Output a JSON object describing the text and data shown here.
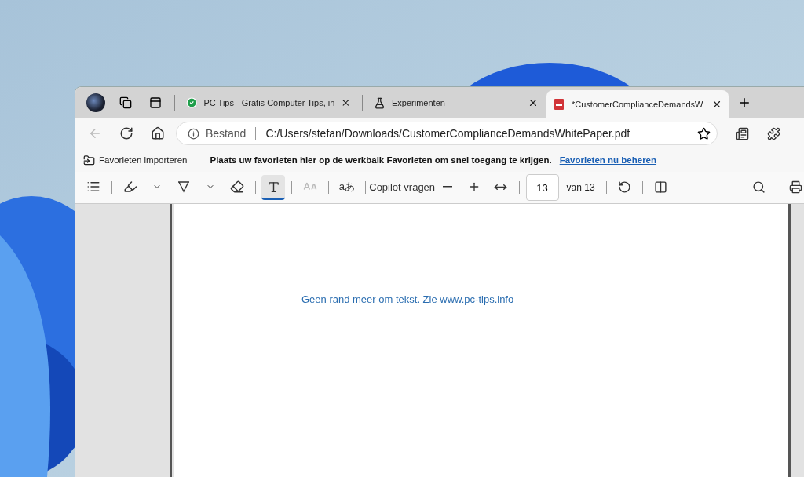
{
  "tabs": [
    {
      "kind": "web",
      "title": "PC Tips - Gratis Computer Tips, in",
      "selected": false
    },
    {
      "kind": "experiment",
      "title": "Experimenten",
      "selected": false
    },
    {
      "kind": "pdf",
      "title": "*CustomerComplianceDemandsW",
      "selected": true
    }
  ],
  "address_bar": {
    "site_info": "Bestand",
    "url": "C:/Users/stefan/Downloads/CustomerComplianceDemandsWhitePaper.pdf"
  },
  "favorites_bar": {
    "import": "Favorieten importeren",
    "hint": "Plaats uw favorieten hier op de werkbalk Favorieten om snel toegang te krijgen.",
    "link": "Favorieten nu beheren"
  },
  "pdf_toolbar": {
    "text_tool_selected": true,
    "read_aloud_disabled": true,
    "translate": "aあ",
    "copilot": "Copilot vragen",
    "page": "13",
    "page_total": "van 13"
  },
  "document": {
    "text": "Geen rand meer om tekst. Zie www.pc-tips.info"
  }
}
